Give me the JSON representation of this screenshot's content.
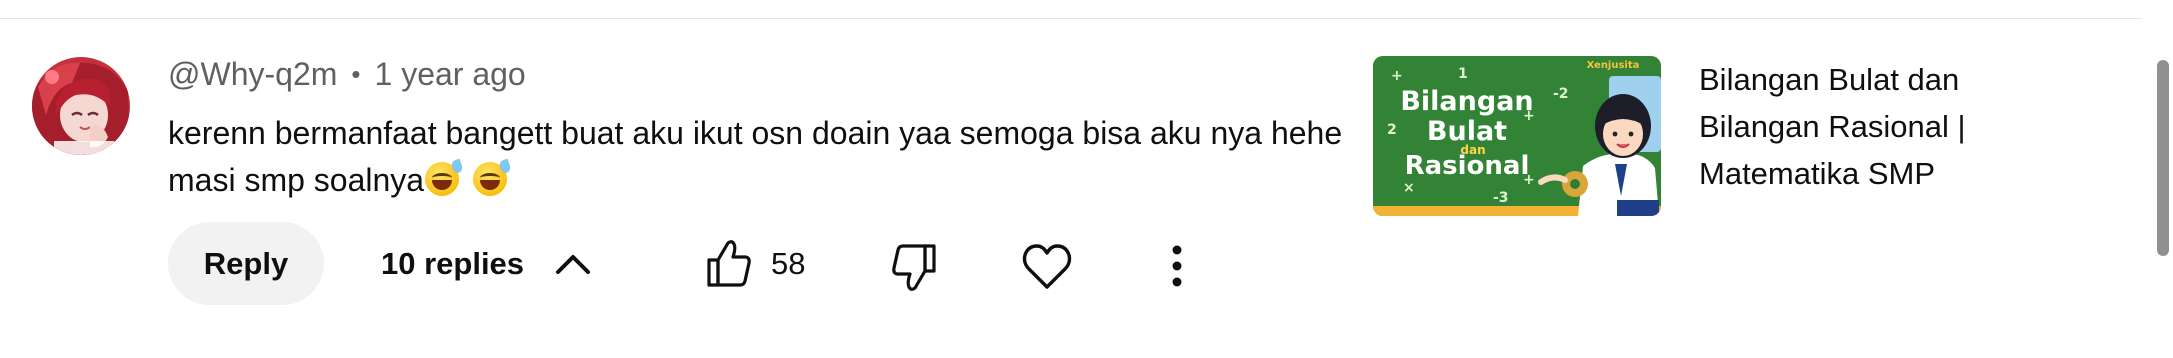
{
  "comment": {
    "author": "@Why-q2m",
    "separator": "•",
    "timestamp": "1 year ago",
    "text": "kerenn bermanfaat bangett buat aku ikut osn doain yaa semoga bisa aku nya hehe masi smp soalnya",
    "emojis": [
      "grinning-face-with-sweat",
      "grinning-face-with-sweat"
    ]
  },
  "actions": {
    "reply_label": "Reply",
    "replies_label": "10 replies",
    "like_count": "58"
  },
  "video": {
    "title": "Bilangan Bulat dan Bilangan Rasional | Matematika SMP",
    "thumbnail": {
      "line1": "Bilangan",
      "line2": "Bulat",
      "connector": "dan",
      "line3": "Rasional",
      "brand": "Xenjusita"
    }
  },
  "colors": {
    "text_primary": "#0f0f0f",
    "text_secondary": "#606060",
    "button_bg": "#f2f2f2",
    "thumbnail_green": "#2e7d32",
    "scrollbar": "#909090"
  },
  "icons": [
    "avatar",
    "chevron-up-icon",
    "thumbs-up-icon",
    "thumbs-down-icon",
    "heart-icon",
    "more-vertical-icon"
  ]
}
